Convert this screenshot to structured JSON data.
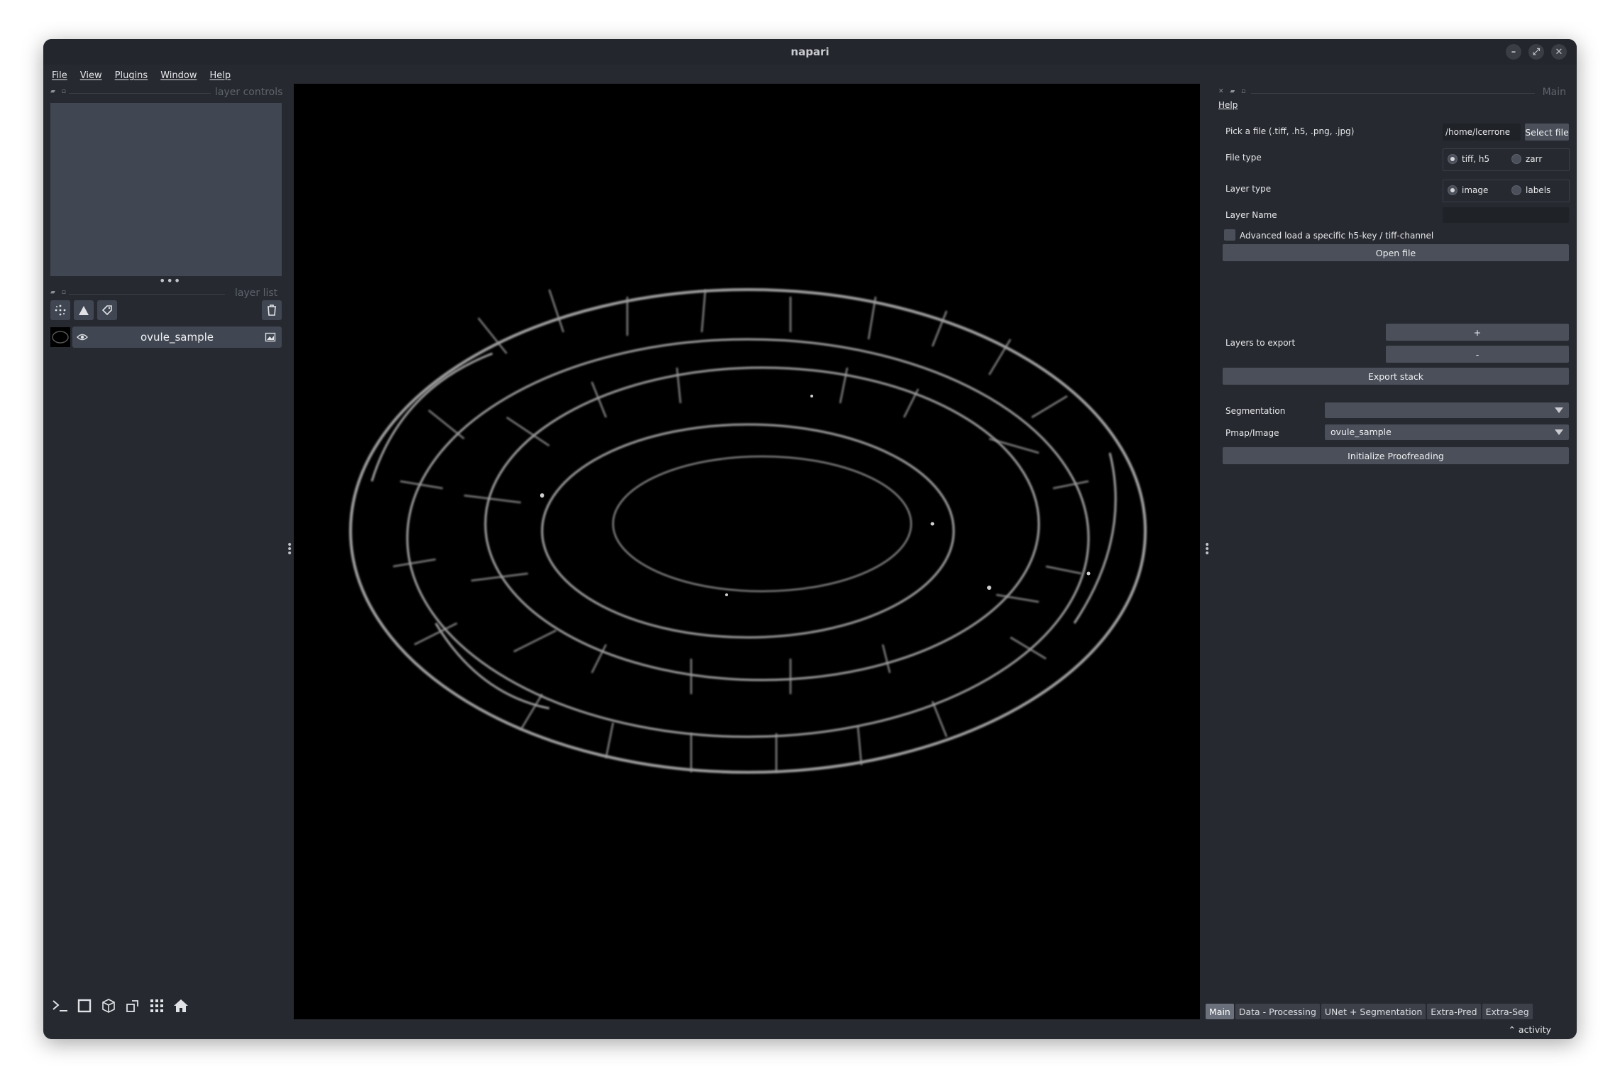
{
  "window": {
    "title": "napari",
    "controls": [
      "–",
      "⤢",
      "✕"
    ]
  },
  "menubar": [
    "File",
    "View",
    "Plugins",
    "Window",
    "Help"
  ],
  "left": {
    "layer_controls_title": "layer controls",
    "layer_list_title": "layer list",
    "layers": [
      {
        "name": "ovule_sample",
        "visible": true,
        "type_icon": "image-icon"
      }
    ]
  },
  "right": {
    "dock_title": "Main",
    "help_label": "Help",
    "pick_file_label": "Pick a file (.tiff, .h5, .png, .jpg)",
    "file_path": "/home/lcerrone",
    "select_file_button": "Select file",
    "file_type_label": "File type",
    "file_type_options": [
      "tiff, h5",
      "zarr"
    ],
    "file_type_selected": "tiff, h5",
    "layer_type_label": "Layer type",
    "layer_type_options": [
      "image",
      "labels"
    ],
    "layer_type_selected": "image",
    "layer_name_label": "Layer Name",
    "layer_name_value": "",
    "advanced_checkbox_label": "Advanced load a specific h5-key / tiff-channel",
    "open_file_button": "Open file",
    "layers_to_export_label": "Layers to export",
    "add_button": "+",
    "remove_button": "-",
    "export_stack_button": "Export stack",
    "segmentation_label": "Segmentation",
    "segmentation_value": "",
    "pmap_label": "Pmap/Image",
    "pmap_value": "ovule_sample",
    "initialize_button": "Initialize Proofreading"
  },
  "tabs": [
    "Main",
    "Data - Processing",
    "UNet + Segmentation",
    "Extra-Pred",
    "Extra-Seg"
  ],
  "active_tab": "Main",
  "activity_label": "⌃ activity"
}
